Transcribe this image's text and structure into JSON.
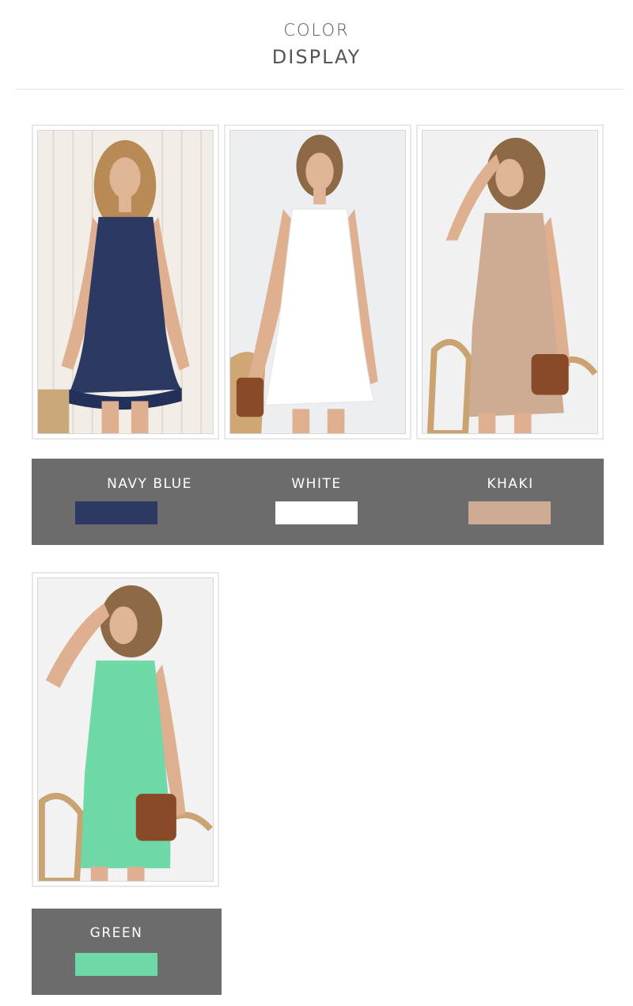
{
  "header": {
    "line1": "COLOR",
    "line2": "DISPLAY"
  },
  "colors": [
    {
      "name": "NAVY BLUE",
      "hex": "#2c3963"
    },
    {
      "name": "WHITE",
      "hex": "#ffffff"
    },
    {
      "name": "KHAKI",
      "hex": "#ceab93"
    },
    {
      "name": "GREEN",
      "hex": "#6ed8a7"
    }
  ]
}
